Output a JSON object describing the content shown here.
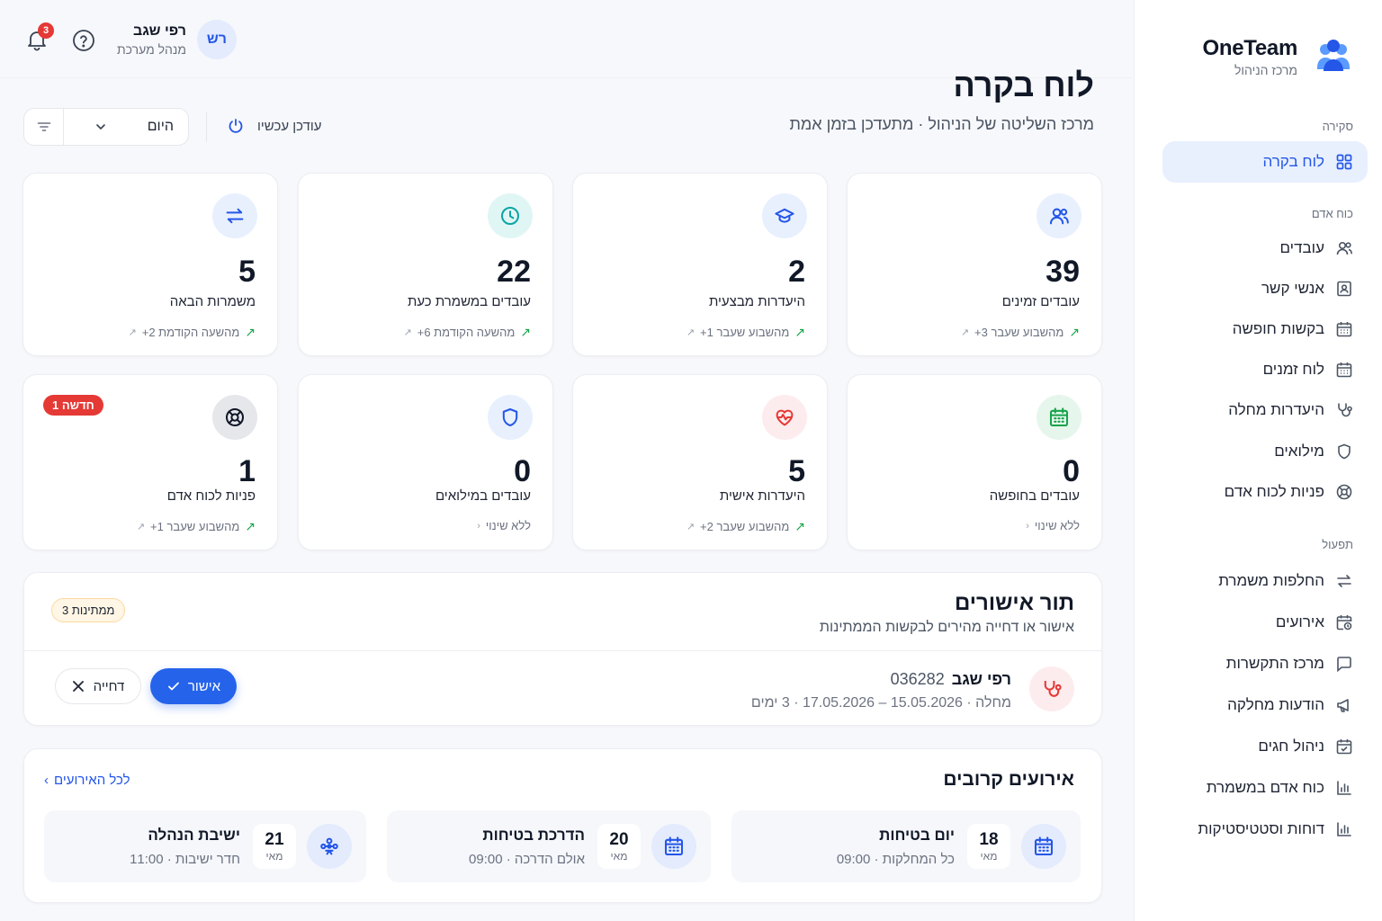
{
  "brand": {
    "name": "OneTeam",
    "subtitle": "מרכז הניהול"
  },
  "sidebar": {
    "sections": [
      {
        "title": "סקירה",
        "items": [
          {
            "label": "לוח בקרה",
            "icon": "grid-icon",
            "active": true
          }
        ]
      },
      {
        "title": "כוח אדם",
        "items": [
          {
            "label": "עובדים",
            "icon": "users-icon"
          },
          {
            "label": "אנשי קשר",
            "icon": "contact-book-icon"
          },
          {
            "label": "בקשות חופשה",
            "icon": "calendar-icon"
          },
          {
            "label": "לוח זמנים",
            "icon": "calendar-icon"
          },
          {
            "label": "היעדרות מחלה",
            "icon": "stethoscope-icon"
          },
          {
            "label": "מילואים",
            "icon": "shield-icon"
          },
          {
            "label": "פניות לכוח אדם",
            "icon": "lifebuoy-icon"
          }
        ]
      },
      {
        "title": "תפעול",
        "items": [
          {
            "label": "החלפות משמרת",
            "icon": "swap-icon"
          },
          {
            "label": "אירועים",
            "icon": "calendar-clock-icon"
          },
          {
            "label": "מרכז התקשרות",
            "icon": "chat-icon"
          },
          {
            "label": "הודעות מחלקה",
            "icon": "megaphone-icon"
          },
          {
            "label": "ניהול חגים",
            "icon": "calendar-check-icon"
          },
          {
            "label": "כוח אדם במשמרת",
            "icon": "bar-chart-icon"
          },
          {
            "label": "דוחות וסטטיסטיקות",
            "icon": "bar-chart-icon"
          }
        ]
      }
    ]
  },
  "topbar": {
    "user_name": "רפי שגב",
    "user_role": "מנהל מערכת",
    "avatar_initials": "רש",
    "notifications_count": "3"
  },
  "header": {
    "title": "לוח בקרה",
    "subtitle": "מרכז השליטה של הניהול · מתעדכן בזמן אמת",
    "period_select": "היום",
    "updated_label": "עודכן עכשיו"
  },
  "stats": [
    {
      "value": "39",
      "label": "עובדים זמינים",
      "foot": "+3 מהשבוע שעבר",
      "icon": "users-icon",
      "color": "#2456e8",
      "bg": "#e8f0fe",
      "trend": "up"
    },
    {
      "value": "2",
      "label": "היעדרות מבצעית",
      "foot": "+1 מהשבוע שעבר",
      "icon": "graduation-cap-icon",
      "color": "#2456e8",
      "bg": "#e8f0fe",
      "trend": "up"
    },
    {
      "value": "22",
      "label": "עובדים במשמרת כעת",
      "foot": "+6 מהשעה הקודמת",
      "icon": "clock-icon",
      "color": "#0ea5a5",
      "bg": "#e0f6f5",
      "trend": "up"
    },
    {
      "value": "5",
      "label": "משמרות הבאה",
      "foot": "+2 מהשעה הקודמת",
      "icon": "swap-icon",
      "color": "#2456e8",
      "bg": "#e8f0fe",
      "trend": "up"
    },
    {
      "value": "0",
      "label": "עובדים בחופשה",
      "foot": "ללא שינוי",
      "icon": "calendar-icon",
      "color": "#16a34a",
      "bg": "#e6f6ec",
      "trend": "none"
    },
    {
      "value": "5",
      "label": "היעדרות אישית",
      "foot": "+2 מהשבוע שעבר",
      "icon": "heart-pulse-icon",
      "color": "#e53935",
      "bg": "#fdecee",
      "trend": "up"
    },
    {
      "value": "0",
      "label": "עובדים במילואים",
      "foot": "ללא שינוי",
      "icon": "shield-icon",
      "color": "#2456e8",
      "bg": "#e8f0fe",
      "trend": "none"
    },
    {
      "value": "1",
      "label": "פניות לכוח אדם",
      "foot": "+1 מהשבוע שעבר",
      "icon": "lifebuoy-icon",
      "color": "#111827",
      "bg": "#e5e7eb",
      "trend": "up",
      "badge": "1 חדשה"
    }
  ],
  "approvals": {
    "title": "תור אישורים",
    "subtitle": "אישור או דחייה מהירים לבקשות הממתינות",
    "pending_badge": "3 ממתינות",
    "request": {
      "name": "רפי שגב",
      "id": "036282",
      "detail": "מחלה · 15.05.2026 – 17.05.2026 · 3 ימים",
      "approve_label": "אישור",
      "reject_label": "דחייה"
    }
  },
  "events": {
    "title": "אירועים קרובים",
    "all_link": "לכל האירועים",
    "items": [
      {
        "title": "יום בטיחות",
        "sub": "כל המחלקות · 09:00",
        "day": "18",
        "month": "מאי",
        "icon": "calendar-icon"
      },
      {
        "title": "הדרכת בטיחות",
        "sub": "אולם הדרכה · 09:00",
        "day": "20",
        "month": "מאי",
        "icon": "calendar-icon"
      },
      {
        "title": "ישיבת הנהלה",
        "sub": "חדר ישיבות · 11:00",
        "day": "21",
        "month": "מאי",
        "icon": "team-meeting-icon"
      }
    ]
  },
  "colors": {
    "accent": "#2456e8",
    "danger": "#e53935",
    "success": "#16a34a"
  }
}
